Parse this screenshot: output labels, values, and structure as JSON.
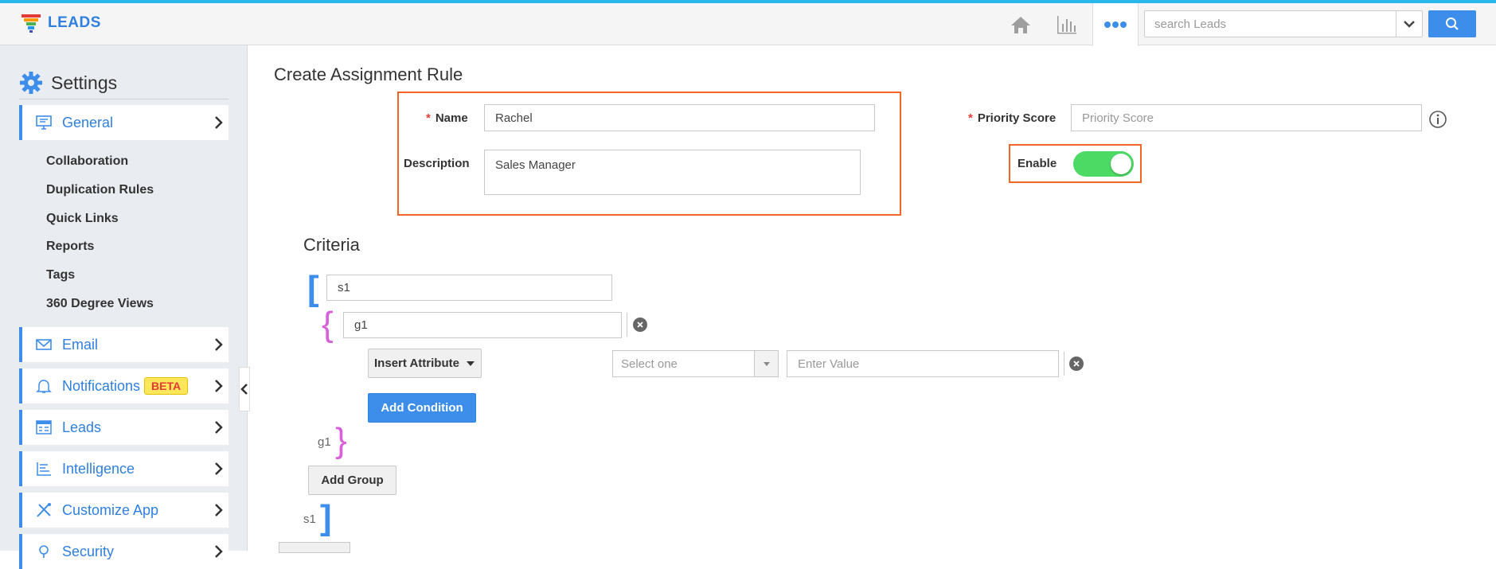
{
  "app": {
    "name": "LEADS"
  },
  "header": {
    "nav_icons": [
      "home-icon",
      "bar-chart-icon",
      "more-dots-icon"
    ],
    "search": {
      "placeholder": "search Leads",
      "value": ""
    }
  },
  "sidebar": {
    "title": "Settings",
    "general": {
      "label": "General"
    },
    "general_subitems": [
      "Collaboration",
      "Duplication Rules",
      "Quick Links",
      "Reports",
      "Tags",
      "360 Degree Views"
    ],
    "items": [
      {
        "label": "Email",
        "icon": "envelope-icon"
      },
      {
        "label": "Notifications",
        "icon": "bell-icon",
        "badge": "BETA"
      },
      {
        "label": "Leads",
        "icon": "leads-list-icon"
      },
      {
        "label": "Intelligence",
        "icon": "intelligence-icon"
      },
      {
        "label": "Customize App",
        "icon": "tools-icon"
      },
      {
        "label": "Security",
        "icon": "security-icon"
      }
    ]
  },
  "form": {
    "title": "Create Assignment Rule",
    "name": {
      "label": "Name",
      "value": "Rachel"
    },
    "description": {
      "label": "Description",
      "value": "Sales Manager"
    },
    "priority_score": {
      "label": "Priority Score",
      "placeholder": "Priority Score"
    },
    "enable": {
      "label": "Enable",
      "on": true
    }
  },
  "criteria": {
    "title": "Criteria",
    "set_name": "s1",
    "group_name": "g1",
    "insert_attribute_label": "Insert Attribute",
    "operator_placeholder": "Select one",
    "value_placeholder": "Enter Value",
    "add_condition_label": "Add Condition",
    "add_group_label": "Add Group",
    "group_close_tag": "g1",
    "set_close_tag": "s1"
  },
  "colors": {
    "accent": "#3d8eea",
    "top_border": "#29b6e8",
    "highlight": "#f26522",
    "toggle_on": "#4cd964",
    "group_bracket": "#d860d8"
  }
}
